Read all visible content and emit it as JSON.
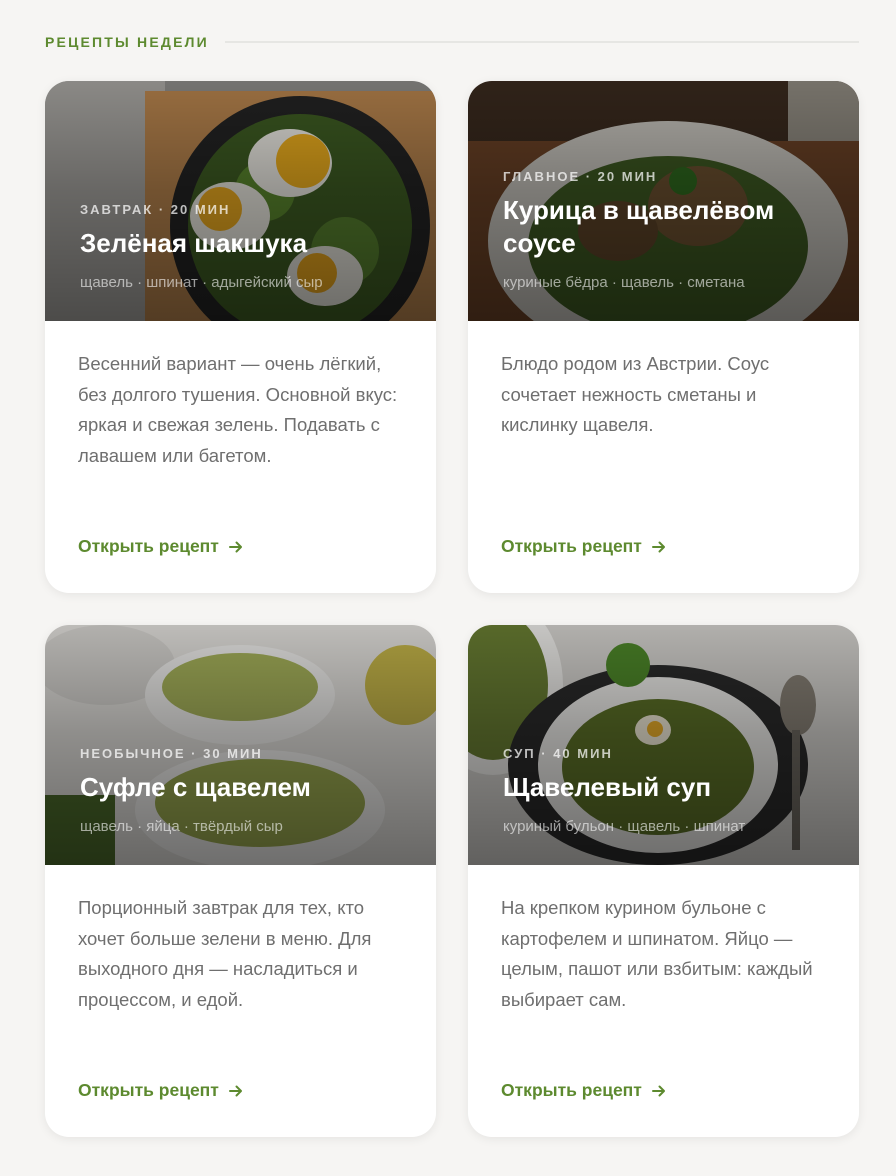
{
  "section": {
    "title": "РЕЦЕПТЫ НЕДЕЛИ"
  },
  "recipes": [
    {
      "meta": "ЗАВТРАК · 20 МИН",
      "title": "Зелёная шакшука",
      "ingredients": "щавель · шпинат · адыгейский сыр",
      "description": "Весенний вариант — очень лёгкий, без долгого тушения. Основной вкус: яркая и свежая зелень. Подавать с лавашем или багетом.",
      "link_label": "Открыть рецепт",
      "image": "photo of green shakshuka in skillet"
    },
    {
      "meta": "ГЛАВНОЕ · 20 МИН",
      "title": "Курица в щавелёвом соусе",
      "ingredients": "куриные бёдра · щавель · сметана",
      "description": "Блюдо родом из Австрии. Соус сочетает нежность сметаны и кислинку щавеля.",
      "link_label": "Открыть рецепт",
      "image": "photo of chicken in sorrel sauce"
    },
    {
      "meta": "НЕОБЫЧНОЕ · 30 МИН",
      "title": "Суфле с щавелем",
      "ingredients": "щавель · яйца · твёрдый сыр",
      "description": "Порционный завтрак для тех, кто хочет больше зелени в меню. Для выходного дня — насладиться и процессом, и едой.",
      "link_label": "Открыть рецепт",
      "image": "photo of sorrel souffle ramekins"
    },
    {
      "meta": "СУП · 40 МИН",
      "title": "Щавелевый суп",
      "ingredients": "куриный бульон · щавель · шпинат",
      "description": "На крепком курином бульоне с картофелем и шпинатом. Яйцо — целым, пашот или взбитым: каждый выбирает сам.",
      "link_label": "Открыть рецепт",
      "image": "photo of sorrel soup with egg"
    }
  ],
  "colors": {
    "accent": "#5d8a2f",
    "background": "#f6f5f3",
    "card": "#ffffff",
    "text_muted": "#6f6f6f"
  },
  "icons": {
    "link_arrow": "arrow-right-icon"
  }
}
